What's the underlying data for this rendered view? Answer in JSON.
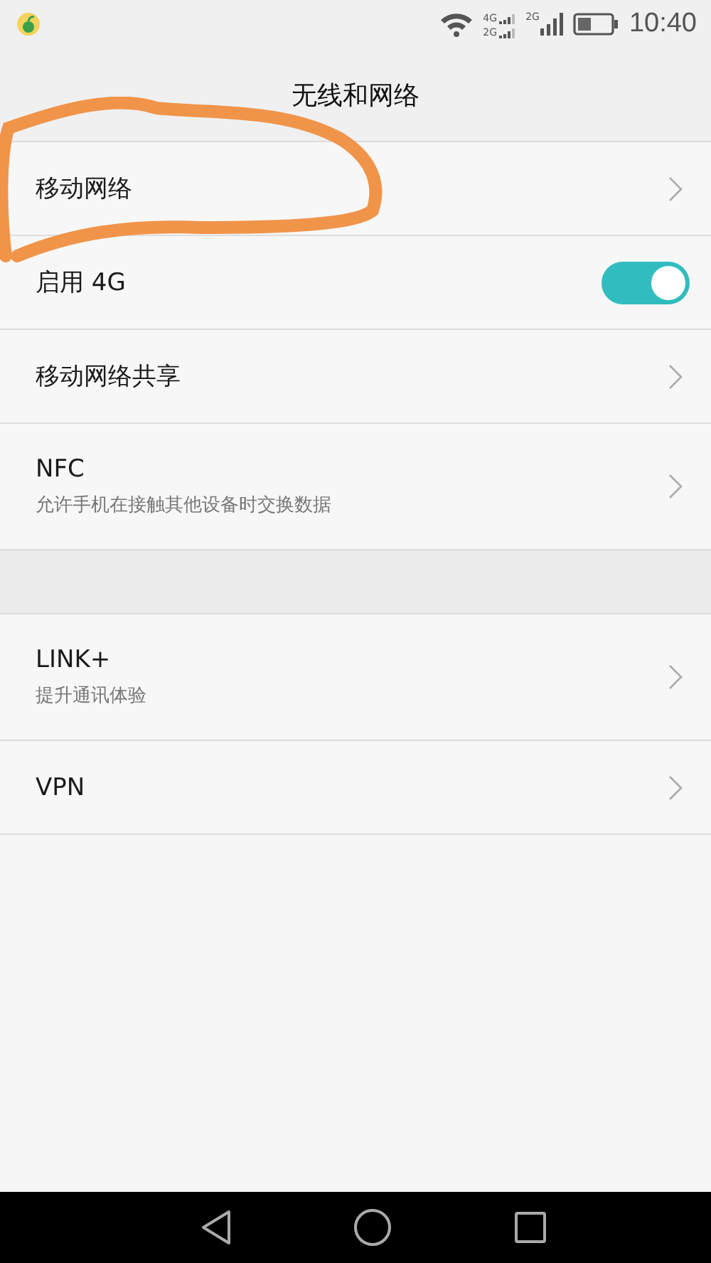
{
  "status_bar": {
    "sim1_labels": [
      "4G",
      "2G"
    ],
    "sim2_label": "2G",
    "time": "10:40"
  },
  "title": "无线和网络",
  "sections": [
    {
      "rows": [
        {
          "kind": "chevron",
          "label": "移动网络",
          "circled": true
        },
        {
          "kind": "switch",
          "label": "启用 4G",
          "on": true,
          "circled": false
        },
        {
          "kind": "chevron",
          "label": "移动网络共享",
          "circled": false
        },
        {
          "kind": "chevron",
          "label": "NFC",
          "subtitle": "允许手机在接触其他设备时交换数据",
          "circled": false
        }
      ]
    },
    {
      "rows": [
        {
          "kind": "chevron",
          "label": "LINK+",
          "subtitle": "提升通讯体验",
          "circled": false
        },
        {
          "kind": "chevron",
          "label": "VPN",
          "circled": false
        }
      ]
    }
  ]
}
